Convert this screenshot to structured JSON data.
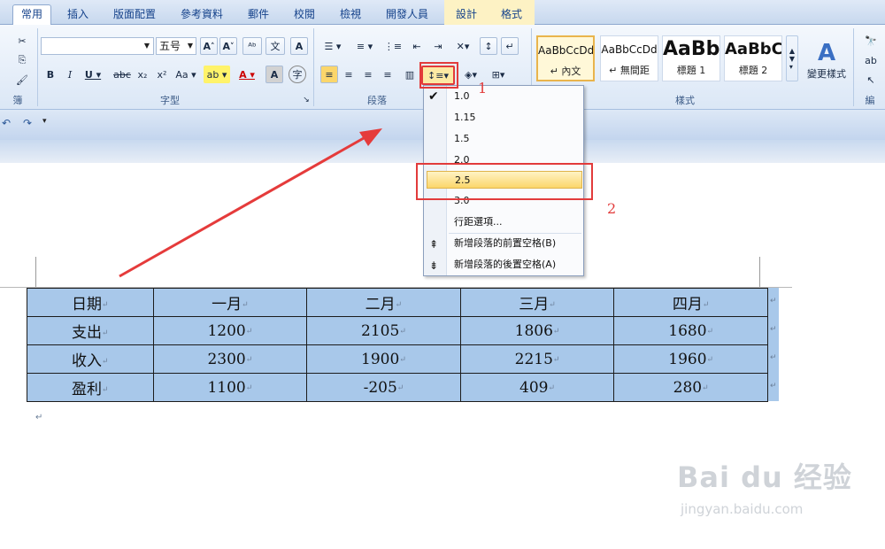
{
  "tabs": [
    "常用",
    "插入",
    "版面配置",
    "參考資料",
    "郵件",
    "校閱",
    "檢視",
    "開發人員",
    "設計",
    "格式"
  ],
  "ribbon": {
    "font_name": "",
    "font_size": "五号",
    "group_labels": {
      "clipboard": "簿",
      "font": "字型",
      "paragraph": "段落",
      "styles": "樣式",
      "edit": "編"
    },
    "styles": [
      {
        "preview": "AaBbCcDd",
        "name": "↵ 內文"
      },
      {
        "preview": "AaBbCcDd",
        "name": "↵ 無間距"
      },
      {
        "preview": "AaBb",
        "name": "標題 1"
      },
      {
        "preview": "AaBbC",
        "name": "標題 2"
      }
    ],
    "change_styles": "變更樣式"
  },
  "menu": {
    "items": [
      "1.0",
      "1.15",
      "1.5",
      "2.0",
      "2.5",
      "3.0",
      "行距選項..."
    ],
    "checked": "1.0",
    "highlighted": "2.5",
    "add_before": "新增段落的前置空格(B)",
    "add_after": "新增段落的後置空格(A)"
  },
  "annotations": {
    "one": "1",
    "two": "2"
  },
  "table": {
    "header": [
      "日期",
      "一月",
      "二月",
      "三月",
      "四月"
    ],
    "rows": [
      [
        "支出",
        "1200",
        "2105",
        "1806",
        "1680"
      ],
      [
        "收入",
        "2300",
        "1900",
        "2215",
        "1960"
      ],
      [
        "盈利",
        "1100",
        "-205",
        "409",
        "280"
      ]
    ]
  },
  "para_mark": "↵",
  "watermark": {
    "logo": "Bai du 经验",
    "url": "jingyan.baidu.com"
  }
}
